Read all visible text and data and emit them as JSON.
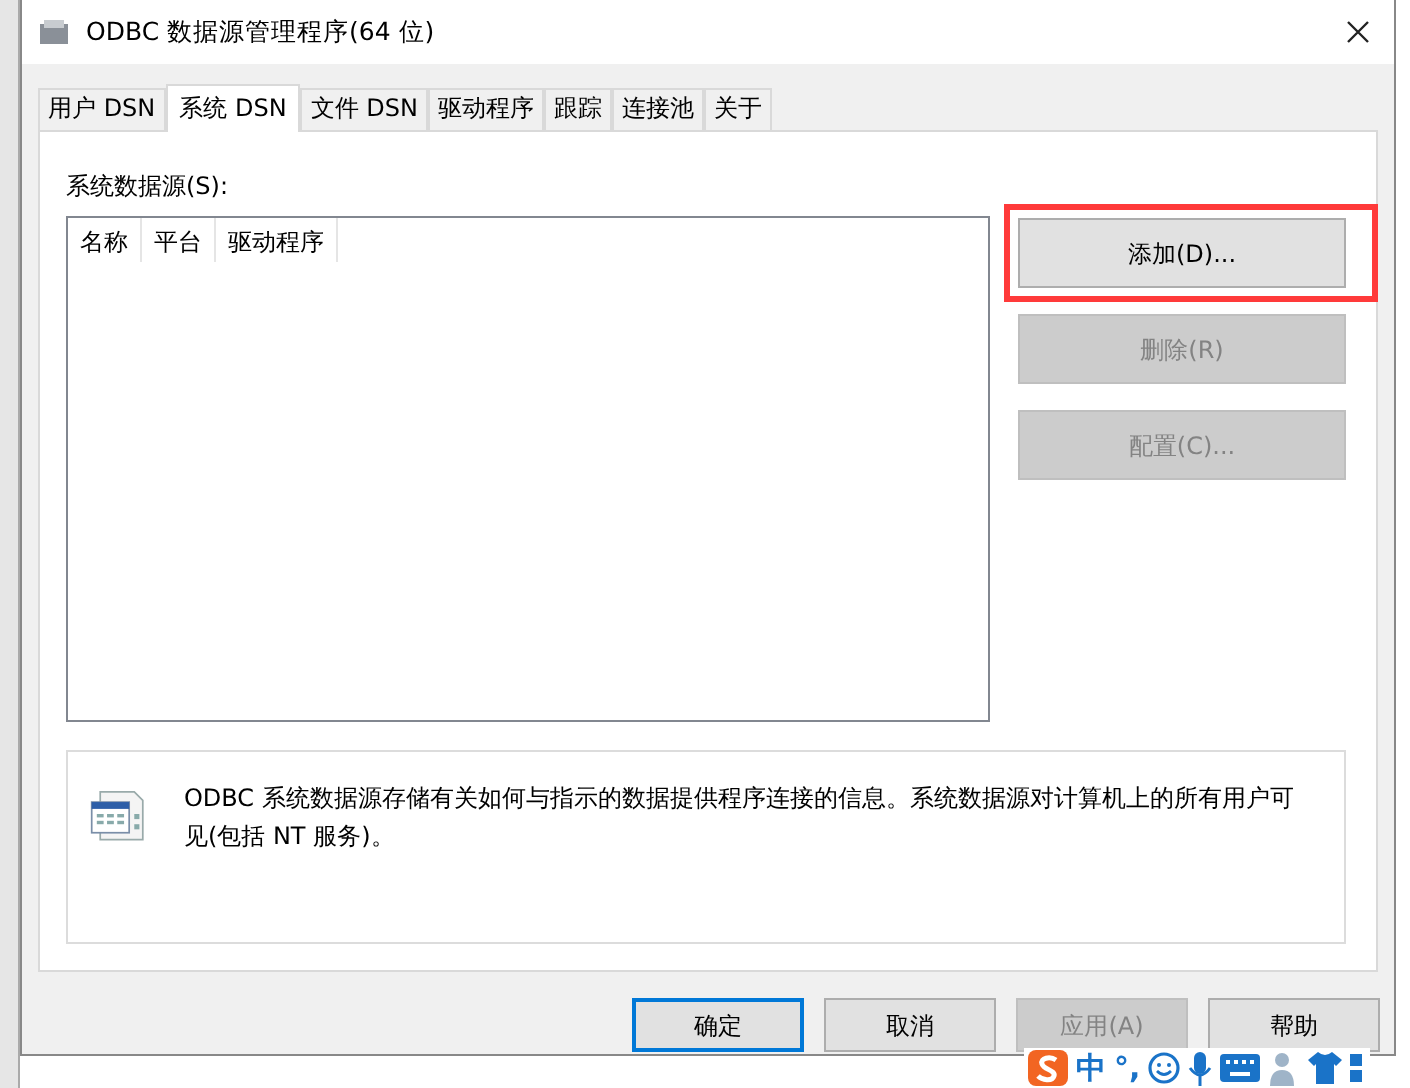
{
  "window": {
    "title": "ODBC 数据源管理程序(64 位)"
  },
  "tabs": [
    {
      "label": "用户 DSN",
      "selected": false
    },
    {
      "label": "系统 DSN",
      "selected": true
    },
    {
      "label": "文件 DSN",
      "selected": false
    },
    {
      "label": "驱动程序",
      "selected": false
    },
    {
      "label": "跟踪",
      "selected": false
    },
    {
      "label": "连接池",
      "selected": false
    },
    {
      "label": "关于",
      "selected": false
    }
  ],
  "data_sources": {
    "label": "系统数据源(S):",
    "columns": [
      "名称",
      "平台",
      "驱动程序"
    ]
  },
  "side_buttons": [
    {
      "label": "添加(D)...",
      "disabled": false,
      "highlighted": true
    },
    {
      "label": "删除(R)",
      "disabled": true,
      "highlighted": false
    },
    {
      "label": "配置(C)...",
      "disabled": true,
      "highlighted": false
    }
  ],
  "info": {
    "text": "ODBC 系统数据源存储有关如何与指示的数据提供程序连接的信息。系统数据源对计算机上的所有用户可见(包括 NT 服务)。"
  },
  "footer_buttons": [
    {
      "label": "确定",
      "disabled": false,
      "default": true
    },
    {
      "label": "取消",
      "disabled": false,
      "default": false
    },
    {
      "label": "应用(A)",
      "disabled": true,
      "default": false
    },
    {
      "label": "帮助",
      "disabled": false,
      "default": false
    }
  ],
  "ime_toolbar": {
    "language": "中",
    "punctuation": "°,"
  }
}
